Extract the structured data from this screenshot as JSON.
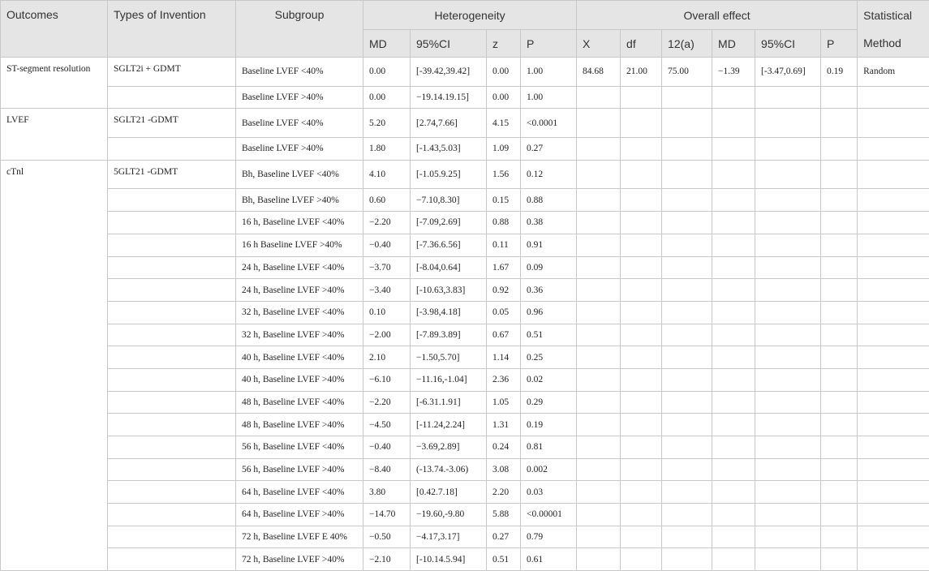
{
  "header": {
    "outcomes": "Outcomes",
    "types": "Types of Invention",
    "subgroup": "Subgroup",
    "heterogeneity": "Heterogeneity",
    "overall": "Overall effect",
    "statistical": "Statistical",
    "sub": [
      "MD",
      "95%CI",
      "z",
      "P",
      "X",
      "df",
      "12(a)",
      "MD",
      "95%CI",
      "P",
      "Method"
    ]
  },
  "groups": [
    {
      "outcome": "ST-segment resolution",
      "type": "SGLT2i + GDMT",
      "rows": [
        [
          "Baseline LVEF <40%",
          "0.00",
          "[-39.42,39.42]",
          "0.00",
          "1.00",
          "84.68",
          "21.00",
          "75.00",
          "−1.39",
          "[-3.47,0.69]",
          "0.19",
          "Random"
        ],
        [
          "Baseline LVEF >40%",
          "0.00",
          "−19.14.19.15]",
          "0.00",
          "1.00",
          "",
          "",
          "",
          "",
          "",
          "",
          ""
        ]
      ]
    },
    {
      "outcome": "LVEF",
      "type": "SGLT21 -GDMT",
      "rows": [
        [
          "Baseline LVEF <40%",
          "5.20",
          "[2.74,7.66]",
          "4.15",
          "<0.0001",
          "",
          "",
          "",
          "",
          "",
          "",
          ""
        ],
        [
          "Baseline LVEF >40%",
          "1.80",
          "[-1.43,5.03]",
          "1.09",
          "0.27",
          "",
          "",
          "",
          "",
          "",
          "",
          ""
        ]
      ]
    },
    {
      "outcome": "cTnl",
      "type": "5GLT21 -GDMT",
      "rows": [
        [
          "Bh, Baseline LVEF <40%",
          "4.10",
          "[-1.05.9.25]",
          "1.56",
          "0.12",
          "",
          "",
          "",
          "",
          "",
          "",
          ""
        ],
        [
          "Bh, Baseline LVEF >40%",
          "0.60",
          "−7.10,8.30]",
          "0.15",
          "0.88",
          "",
          "",
          "",
          "",
          "",
          "",
          ""
        ],
        [
          "16 h, Baseline LVEF <40%",
          "−2.20",
          "[-7.09,2.69]",
          "0.88",
          "0.38",
          "",
          "",
          "",
          "",
          "",
          "",
          ""
        ],
        [
          "16 h Baseline LVEF >40%",
          "−0.40",
          "[-7.36.6.56]",
          "0.11",
          "0.91",
          "",
          "",
          "",
          "",
          "",
          "",
          ""
        ],
        [
          "24 h, Baseline LVEF <40%",
          "−3.70",
          "[-8.04,0.64]",
          "1.67",
          "0.09",
          "",
          "",
          "",
          "",
          "",
          "",
          ""
        ],
        [
          "24 h, Baseline LVEF >40%",
          "−3.40",
          "[-10.63,3.83]",
          "0.92",
          "0.36",
          "",
          "",
          "",
          "",
          "",
          "",
          ""
        ],
        [
          "32 h, Baseline LVEF <40%",
          "0.10",
          "[-3.98,4.18]",
          "0.05",
          "0.96",
          "",
          "",
          "",
          "",
          "",
          "",
          ""
        ],
        [
          "32 h, Baseline LVEF >40%",
          "−2.00",
          "[-7.89.3.89]",
          "0.67",
          "0.51",
          "",
          "",
          "",
          "",
          "",
          "",
          ""
        ],
        [
          "40 h, Baseline LVEF <40%",
          "2.10",
          "−1.50,5.70]",
          "1.14",
          "0.25",
          "",
          "",
          "",
          "",
          "",
          "",
          ""
        ],
        [
          "40 h, Baseline LVEF >40%",
          "−6.10",
          "−11.16,-1.04]",
          "2.36",
          "0.02",
          "",
          "",
          "",
          "",
          "",
          "",
          ""
        ],
        [
          "48 h, Baseline LVEF <40%",
          "−2.20",
          "[-6.31.1.91]",
          "1.05",
          "0.29",
          "",
          "",
          "",
          "",
          "",
          "",
          ""
        ],
        [
          "48 h, Baseline LVEF >40%",
          "−4.50",
          "[-11.24,2.24]",
          "1.31",
          "0.19",
          "",
          "",
          "",
          "",
          "",
          "",
          ""
        ],
        [
          "56 h, Baseline LVEF <40%",
          "−0.40",
          "−3.69,2.89]",
          "0.24",
          "0.81",
          "",
          "",
          "",
          "",
          "",
          "",
          ""
        ],
        [
          "56 h, Baseline LVEF >40%",
          "−8.40",
          "(-13.74.-3.06)",
          "3.08",
          "0.002",
          "",
          "",
          "",
          "",
          "",
          "",
          ""
        ],
        [
          "64 h, Baseline LVEF <40%",
          "3.80",
          "[0.42.7.18]",
          "2.20",
          "0.03",
          "",
          "",
          "",
          "",
          "",
          "",
          ""
        ],
        [
          "64 h, Baseline LVEF >40%",
          "−14.70",
          "−19.60,-9.80",
          "5.88",
          "<0.00001",
          "",
          "",
          "",
          "",
          "",
          "",
          ""
        ],
        [
          "72 h, Baseline LVEF E 40%",
          "−0.50",
          "−4.17,3.17]",
          "0.27",
          "0.79",
          "",
          "",
          "",
          "",
          "",
          "",
          ""
        ],
        [
          "72 h, Baseline LVEF >40%",
          "−2.10",
          "[-10.14.5.94]",
          "0.51",
          "0.61",
          "",
          "",
          "",
          "",
          "",
          "",
          ""
        ]
      ]
    }
  ]
}
